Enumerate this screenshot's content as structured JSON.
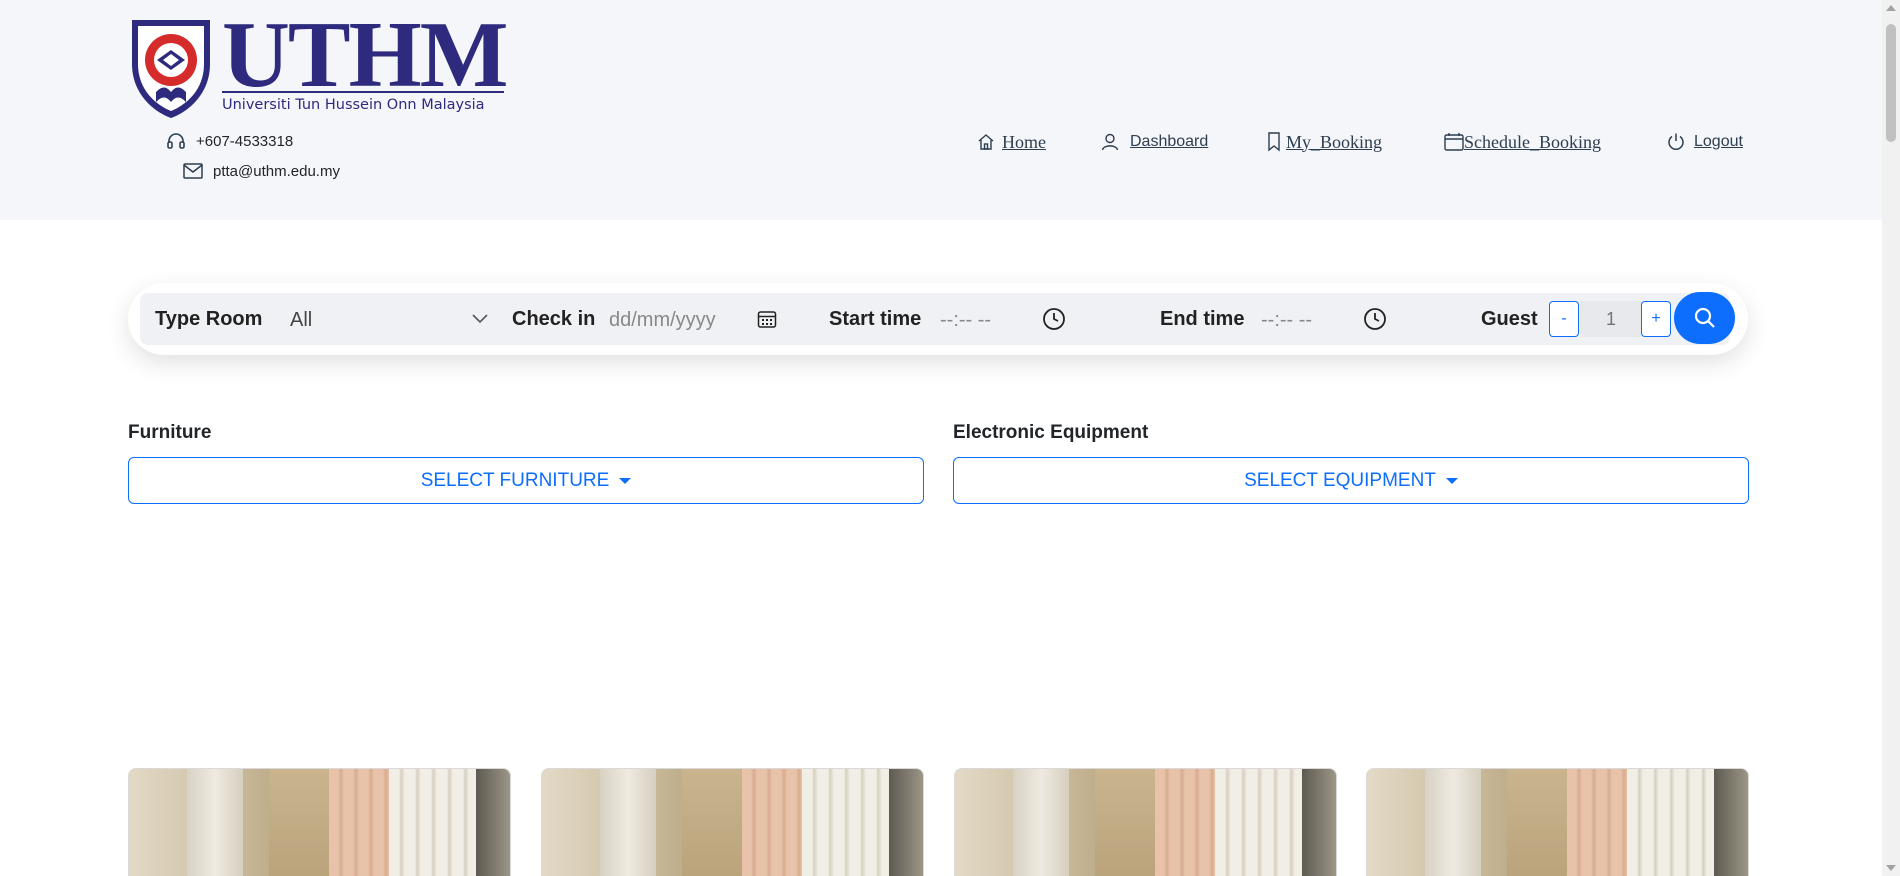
{
  "brand": {
    "logo_text": "UTHM",
    "logo_subtitle": "Universiti Tun Hussein Onn Malaysia",
    "colors": {
      "navy": "#2e2a7e",
      "red": "#d62b2b"
    }
  },
  "contact": {
    "phone": "+607-4533318",
    "email": "ptta@uthm.edu.my",
    "phone_icon": "headset-icon",
    "email_icon": "envelope-icon"
  },
  "nav": {
    "home": "Home",
    "dashboard": "Dashboard",
    "my_booking": "My_Booking",
    "schedule_booking": "Schedule_Booking",
    "logout": "Logout"
  },
  "search": {
    "type_room_label": "Type Room",
    "type_room_value": "All",
    "check_in_label": "Check in",
    "check_in_placeholder": "dd/mm/yyyy",
    "start_time_label": "Start time",
    "start_time_placeholder": "--:-- --",
    "end_time_label": "End time",
    "end_time_placeholder": "--:-- --",
    "guest_label": "Guest",
    "guest_minus": "-",
    "guest_value": "1",
    "guest_plus": "+",
    "accent_color": "#0d6efd"
  },
  "filters": {
    "furniture_label": "Furniture",
    "furniture_button": "SELECT FURNITURE",
    "equipment_label": "Electronic Equipment",
    "equipment_button": "SELECT EQUIPMENT"
  }
}
